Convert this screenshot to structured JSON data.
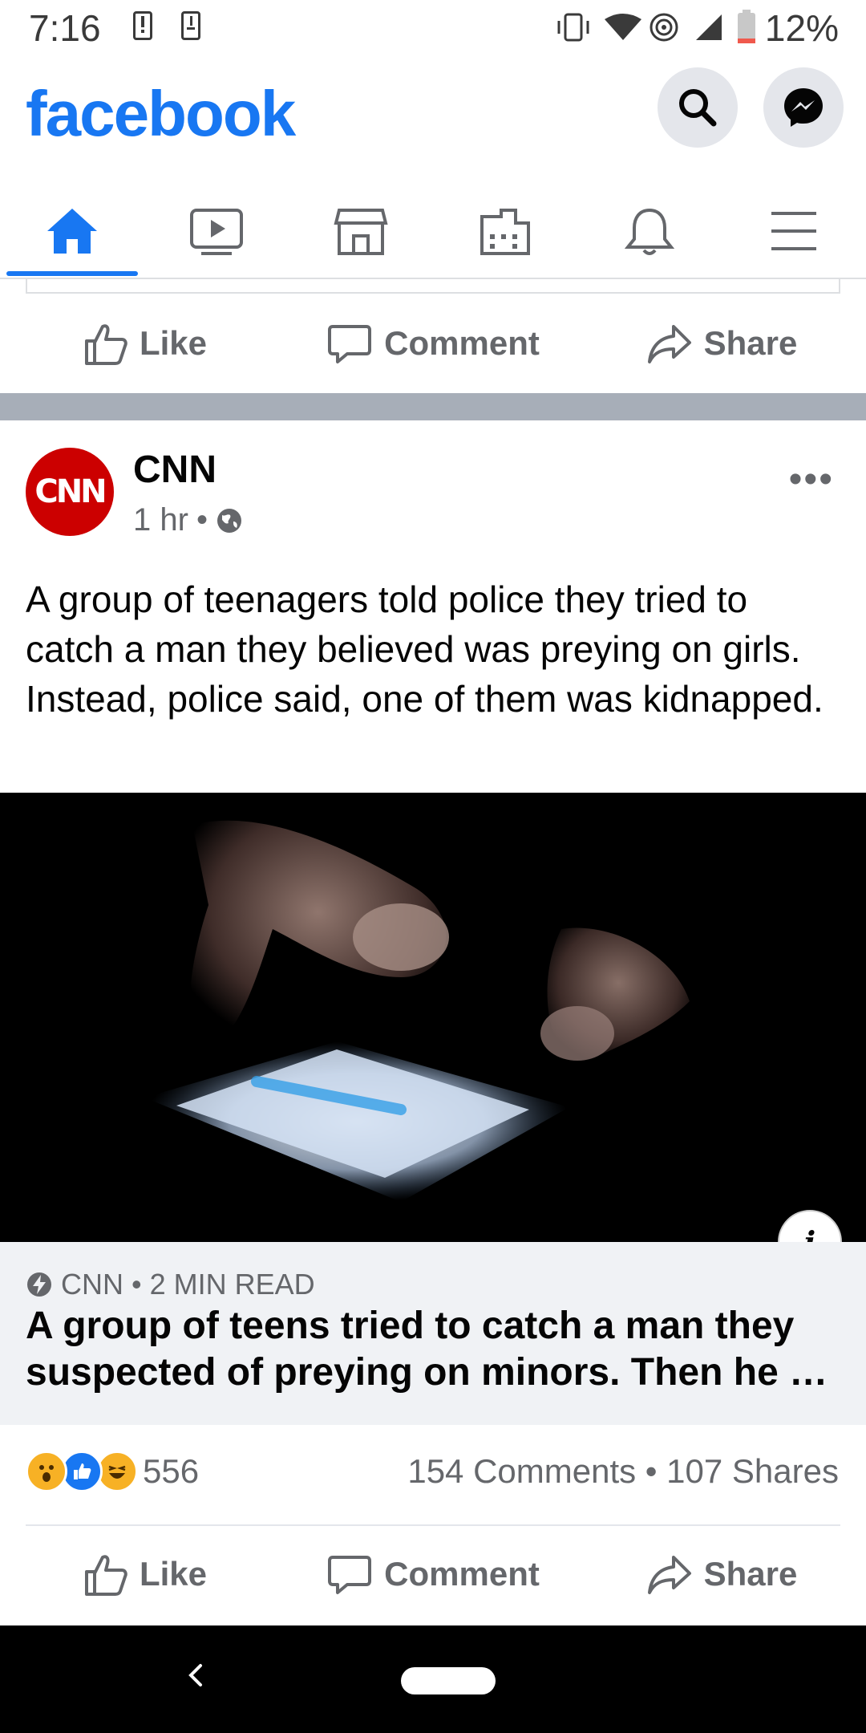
{
  "status_bar": {
    "time": "7:16",
    "battery_percent": "12%",
    "icons": [
      "alert-icon",
      "download-icon",
      "vibrate-icon",
      "wifi-icon",
      "hotspot-icon",
      "signal-icon",
      "battery-icon"
    ]
  },
  "header": {
    "logo": "facebook",
    "buttons": [
      "search-icon",
      "messenger-icon"
    ]
  },
  "nav": {
    "tabs": [
      "home",
      "watch",
      "marketplace",
      "groups",
      "notifications",
      "menu"
    ],
    "active": "home"
  },
  "actions": {
    "like": "Like",
    "comment": "Comment",
    "share": "Share"
  },
  "post": {
    "author": "CNN",
    "avatar_text": "CNN",
    "time": "1 hr",
    "separator": "•",
    "more": "•••",
    "text": "A group of teenagers told police they tried to catch a man they believed was preying on girls. Instead, police said, one of them was kidnapped.",
    "link": {
      "source": "CNN • 2 MIN READ",
      "title": "A group of teens tried to catch a man they suspected of preying on minors. Then he …",
      "info": "i"
    },
    "reactions": {
      "types": [
        "wow",
        "like",
        "haha"
      ],
      "count": "556"
    },
    "stats": "154 Comments • 107 Shares"
  },
  "colors": {
    "brand": "#1877f2",
    "cnn_red": "#cc0000",
    "muted": "#65676b"
  }
}
